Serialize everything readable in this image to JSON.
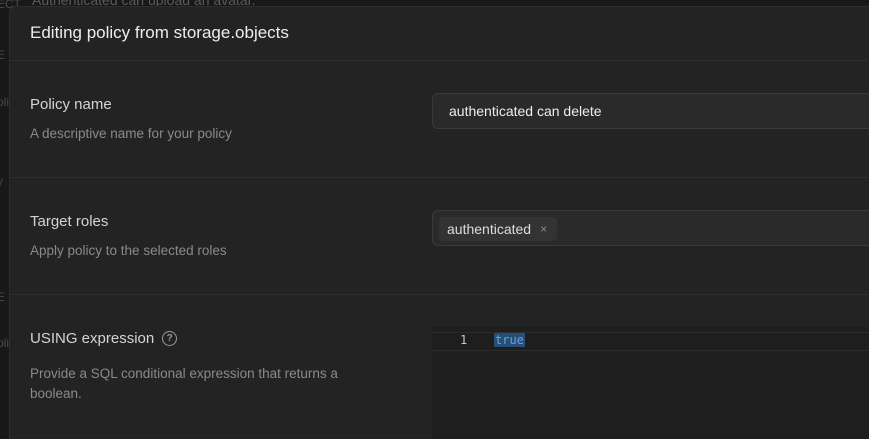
{
  "background": {
    "top_text": "Authenticated can upload an avatar.",
    "edge_fragments": [
      "ECT",
      "E",
      "oli",
      "y",
      "E",
      "oli"
    ]
  },
  "panel": {
    "title": "Editing policy from storage.objects"
  },
  "policy_name": {
    "label": "Policy name",
    "description": "A descriptive name for your policy",
    "value": "authenticated can delete"
  },
  "target_roles": {
    "label": "Target roles",
    "description": "Apply policy to the selected roles",
    "roles": [
      "authenticated"
    ],
    "remove_glyph": "×"
  },
  "using_expression": {
    "label": "USING expression",
    "help_glyph": "?",
    "description": "Provide a SQL conditional expression that returns a boolean.",
    "line_number": "1",
    "code": "true"
  },
  "colors": {
    "panel_bg": "#232323",
    "selection": "#264f78",
    "keyword": "#6f9fd8"
  }
}
